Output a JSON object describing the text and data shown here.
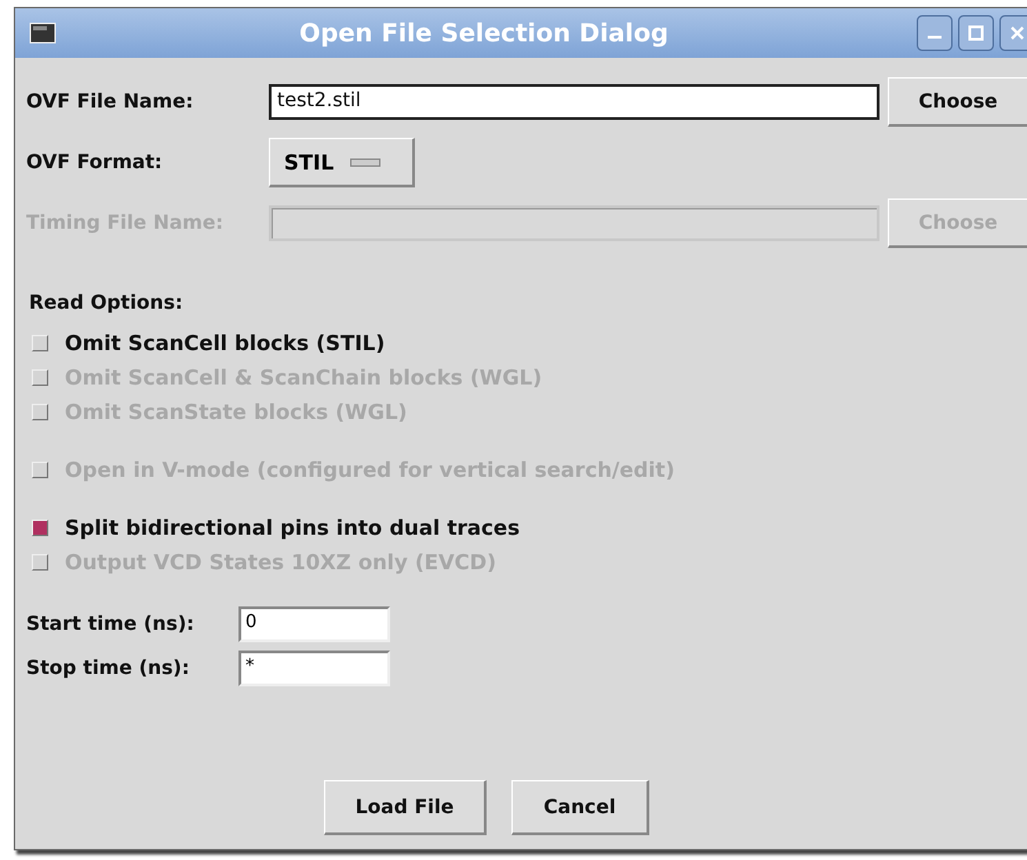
{
  "window": {
    "title": "Open File Selection Dialog"
  },
  "file_name": {
    "label": "OVF File Name:",
    "value": "test2.stil",
    "button": "Choose",
    "disabled": false
  },
  "format": {
    "label": "OVF Format:",
    "value": "STIL"
  },
  "timing_file": {
    "label": "Timing File Name:",
    "button": "Choose",
    "disabled": true
  },
  "read_options": {
    "title": "Read Options:",
    "groups": [
      [
        {
          "label": "Omit ScanCell blocks (STIL)",
          "checked": false,
          "disabled": false
        },
        {
          "label": "Omit ScanCell & ScanChain blocks (WGL)",
          "checked": false,
          "disabled": true
        },
        {
          "label": "Omit ScanState blocks (WGL)",
          "checked": false,
          "disabled": true
        }
      ],
      [
        {
          "label": "Open in V-mode (configured for vertical search/edit)",
          "checked": false,
          "disabled": true
        }
      ],
      [
        {
          "label": "Split bidirectional pins into dual traces",
          "checked": true,
          "disabled": false
        },
        {
          "label": "Output VCD States 10XZ only (EVCD)",
          "checked": false,
          "disabled": true
        }
      ]
    ]
  },
  "times": [
    {
      "label": "Start time (ns):",
      "value": "0"
    },
    {
      "label": "Stop time (ns):",
      "value": "*"
    }
  ],
  "buttons": [
    {
      "label": "Load File"
    },
    {
      "label": "Cancel"
    }
  ]
}
